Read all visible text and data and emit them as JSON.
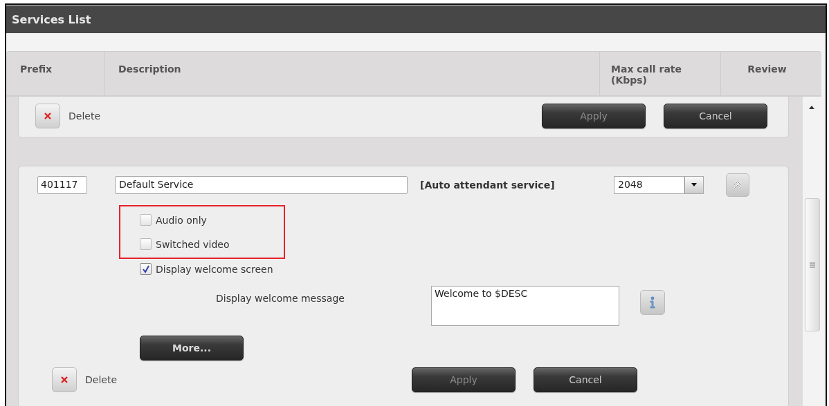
{
  "window": {
    "title": "Services List"
  },
  "table": {
    "columns": [
      "Prefix",
      "Description",
      "Max call rate (Kbps)",
      "Review"
    ]
  },
  "services": [
    {
      "kind": "footer",
      "delete": "Delete",
      "buttons": [
        {
          "label": "Apply",
          "disabled": true
        },
        {
          "label": "Cancel",
          "disabled": false
        }
      ]
    },
    {
      "kind": "expanded",
      "prefix": "401117",
      "description": "Default Service",
      "type_label": "[Auto attendant service]",
      "max_call_rate": "2048",
      "options": [
        {
          "label": "Audio only",
          "checked": false,
          "highlighted": true
        },
        {
          "label": "Switched video",
          "checked": false,
          "highlighted": true
        },
        {
          "label": "Display welcome screen",
          "checked": true,
          "highlighted": false
        }
      ],
      "message_label": "Display welcome message",
      "message": "Welcome to $DESC",
      "more": "More...",
      "delete": "Delete",
      "buttons": [
        {
          "label": "Apply",
          "disabled": true
        },
        {
          "label": "Cancel",
          "disabled": false
        }
      ]
    }
  ]
}
